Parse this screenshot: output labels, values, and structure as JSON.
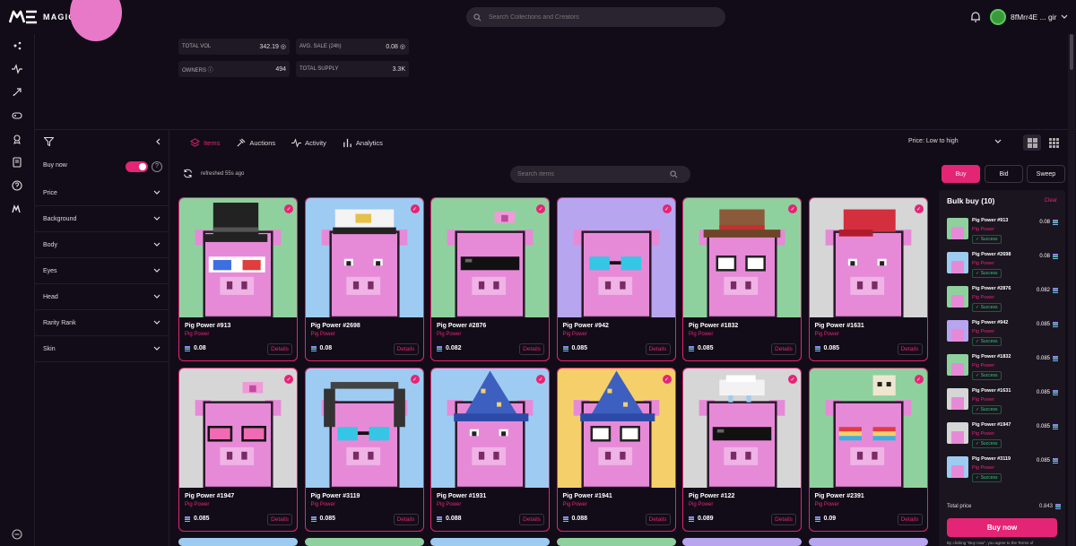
{
  "header": {
    "brand": "MAGIC EDEN",
    "search_placeholder": "Search Collections and Creators",
    "wallet_label": "8fMrr4E ... gir"
  },
  "stats": {
    "total_vol_label": "TOTAL VOL",
    "total_vol": "342.19",
    "avg_sale_label": "AVG. SALE (24h)",
    "avg_sale": "0.08",
    "owners_label": "OWNERS",
    "owners": "494",
    "total_supply_label": "TOTAL SUPPLY",
    "total_supply": "3.3K"
  },
  "filters": {
    "buy_now": "Buy now",
    "buy_now_on": true,
    "items": [
      "Price",
      "Background",
      "Body",
      "Eyes",
      "Head",
      "Rarity Rank",
      "Skin"
    ]
  },
  "tabs": [
    {
      "label": "Items",
      "active": true,
      "icon": "layers-icon"
    },
    {
      "label": "Auctions",
      "active": false,
      "icon": "gavel-icon"
    },
    {
      "label": "Activity",
      "active": false,
      "icon": "activity-icon"
    },
    {
      "label": "Analytics",
      "active": false,
      "icon": "bar-chart-icon"
    }
  ],
  "sort": {
    "label": "Price: Low to high"
  },
  "toolbar": {
    "refreshed": "refreshed 55s ago",
    "search_placeholder": "Search items",
    "buy": "Buy",
    "bid": "Bid",
    "sweep": "Sweep"
  },
  "cards": [
    {
      "name": "Pig Power #913",
      "collection": "Pig Power",
      "price": "0.08",
      "details": "Details",
      "bg": "#8fd19e",
      "hat": "tophat",
      "glasses": "3d"
    },
    {
      "name": "Pig Power #2698",
      "collection": "Pig Power",
      "price": "0.08",
      "details": "Details",
      "bg": "#9ecbf2",
      "hat": "captain",
      "glasses": "none"
    },
    {
      "name": "Pig Power #2876",
      "collection": "Pig Power",
      "price": "0.082",
      "details": "Details",
      "bg": "#8fd19e",
      "hat": "bow",
      "glasses": "shades"
    },
    {
      "name": "Pig Power #942",
      "collection": "Pig Power",
      "price": "0.085",
      "details": "Details",
      "bg": "#b7a5f0",
      "hat": "none",
      "glasses": "diamond"
    },
    {
      "name": "Pig Power #1832",
      "collection": "Pig Power",
      "price": "0.085",
      "details": "Details",
      "bg": "#8fd19e",
      "hat": "cowboy",
      "glasses": "round"
    },
    {
      "name": "Pig Power #1631",
      "collection": "Pig Power",
      "price": "0.085",
      "details": "Details",
      "bg": "#d6d6d6",
      "hat": "cap",
      "glasses": "none"
    },
    {
      "name": "Pig Power #1947",
      "collection": "Pig Power",
      "price": "0.085",
      "details": "Details",
      "bg": "#d6d6d6",
      "hat": "bow",
      "glasses": "heart"
    },
    {
      "name": "Pig Power #3119",
      "collection": "Pig Power",
      "price": "0.085",
      "details": "Details",
      "bg": "#9ecbf2",
      "hat": "headphones",
      "glasses": "diamond"
    },
    {
      "name": "Pig Power #1931",
      "collection": "Pig Power",
      "price": "0.088",
      "details": "Details",
      "bg": "#9ecbf2",
      "hat": "wizard",
      "glasses": "none"
    },
    {
      "name": "Pig Power #1941",
      "collection": "Pig Power",
      "price": "0.088",
      "details": "Details",
      "bg": "#f5d06a",
      "hat": "wizard",
      "glasses": "round"
    },
    {
      "name": "Pig Power #122",
      "collection": "Pig Power",
      "price": "0.089",
      "details": "Details",
      "bg": "#d6d6d6",
      "hat": "cloud",
      "glasses": "shades"
    },
    {
      "name": "Pig Power #2391",
      "collection": "Pig Power",
      "price": "0.09",
      "details": "Details",
      "bg": "#8fd19e",
      "hat": "skull",
      "glasses": "rainbow"
    }
  ],
  "partial_row_colors": [
    "#9ecbf2",
    "#8fd19e",
    "#9ecbf2",
    "#8fd19e",
    "#b7a5f0",
    "#b7a5f0"
  ],
  "cart": {
    "title": "Bulk buy (10)",
    "clear": "Clear",
    "items": [
      {
        "name": "Pig Power #913",
        "collection": "Pig Power",
        "status": "Success",
        "price": "0.08",
        "bg": "#8fd19e"
      },
      {
        "name": "Pig Power #2698",
        "collection": "Pig Power",
        "status": "Success",
        "price": "0.08",
        "bg": "#9ecbf2"
      },
      {
        "name": "Pig Power #2876",
        "collection": "Pig Power",
        "status": "Success",
        "price": "0.082",
        "bg": "#8fd19e"
      },
      {
        "name": "Pig Power #942",
        "collection": "Pig Power",
        "status": "Success",
        "price": "0.085",
        "bg": "#b7a5f0"
      },
      {
        "name": "Pig Power #1832",
        "collection": "Pig Power",
        "status": "Success",
        "price": "0.085",
        "bg": "#8fd19e"
      },
      {
        "name": "Pig Power #1631",
        "collection": "Pig Power",
        "status": "Success",
        "price": "0.085",
        "bg": "#d6d6d6"
      },
      {
        "name": "Pig Power #1947",
        "collection": "Pig Power",
        "status": "Success",
        "price": "0.085",
        "bg": "#d6d6d6"
      },
      {
        "name": "Pig Power #3119",
        "collection": "Pig Power",
        "status": "Success",
        "price": "0.085",
        "bg": "#9ecbf2"
      }
    ],
    "total_label": "Total price",
    "total": "0.843",
    "buy_now": "Buy now",
    "disclaimer": "By clicking \"Buy now\", you agree to the Terms of"
  },
  "colors": {
    "accent": "#e42575",
    "bg": "#120c18",
    "panel": "#1b1520",
    "pig": "#e68ad8"
  }
}
